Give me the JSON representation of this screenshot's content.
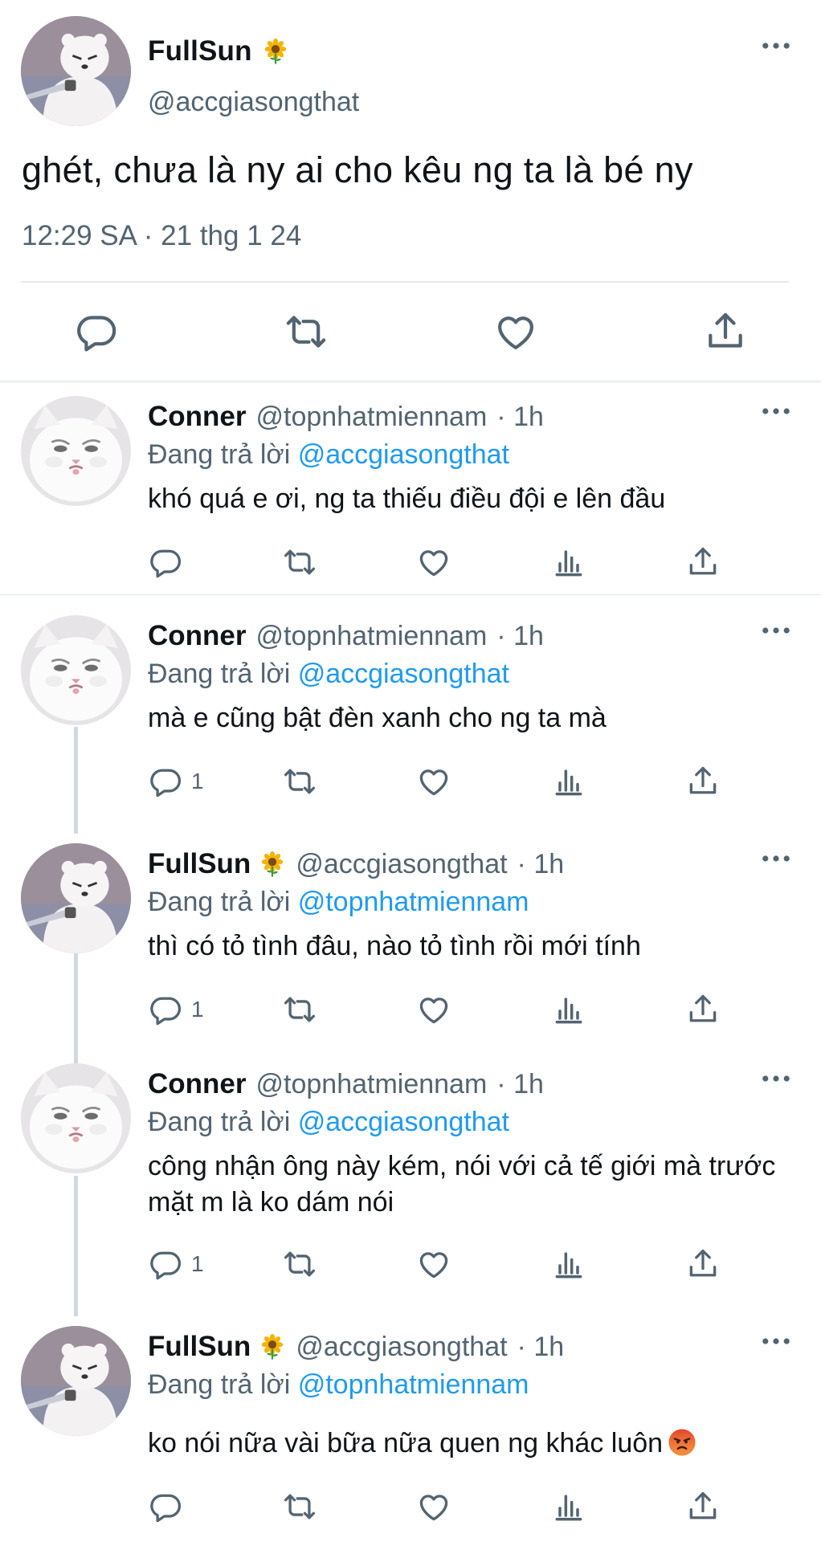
{
  "colors": {
    "link": "#1d9bf0",
    "secondary_text": "#536471",
    "divider": "#eff3f4"
  },
  "main_tweet": {
    "author": {
      "name": "FullSun",
      "handle": "@accgiasongthat",
      "badge_icon": "sunflower-icon"
    },
    "text": "ghét, chưa là ny ai cho kêu ng ta là bé ny",
    "timestamp": "12:29 SA · 21 thg 1 24",
    "actions": [
      "reply-icon",
      "retweet-icon",
      "like-icon",
      "share-icon"
    ]
  },
  "replies": [
    {
      "author": {
        "name": "Conner",
        "handle": "@topnhatmiennam",
        "time": "· 1h"
      },
      "replying_label": "Đang trả lời",
      "replying_to": "@accgiasongthat",
      "text": "khó quá e ơi, ng ta thiếu điều đội e lên đầu",
      "reply_count": ""
    },
    {
      "author": {
        "name": "Conner",
        "handle": "@topnhatmiennam",
        "time": "· 1h"
      },
      "replying_label": "Đang trả lời",
      "replying_to": "@accgiasongthat",
      "text": "mà e cũng bật đèn xanh cho ng ta mà",
      "reply_count": "1"
    },
    {
      "author": {
        "name": "FullSun",
        "handle": "@accgiasongthat",
        "time": "· 1h"
      },
      "replying_label": "Đang trả lời",
      "replying_to": "@topnhatmiennam",
      "text": "thì có tỏ tình đâu, nào tỏ tình rồi mới tính",
      "reply_count": "1"
    },
    {
      "author": {
        "name": "Conner",
        "handle": "@topnhatmiennam",
        "time": "· 1h"
      },
      "replying_label": "Đang trả lời",
      "replying_to": "@accgiasongthat",
      "text": "công nhận ông này kém, nói với cả tế giới mà trước mặt m là ko dám nói",
      "reply_count": "1"
    },
    {
      "author": {
        "name": "FullSun",
        "handle": "@accgiasongthat",
        "time": "· 1h"
      },
      "replying_label": "Đang trả lời",
      "replying_to": "@topnhatmiennam",
      "text": "ko nói nữa vài bữa nữa quen ng khác luôn",
      "reply_count": ""
    }
  ]
}
